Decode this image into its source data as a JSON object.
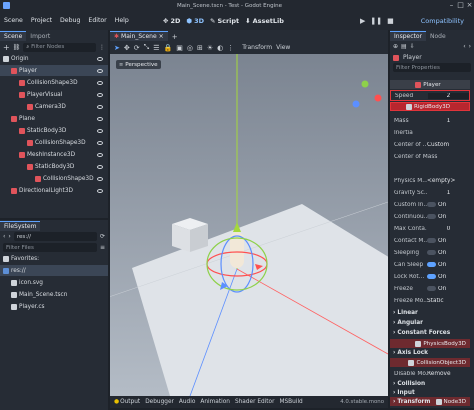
{
  "window": {
    "title": "Main_Scene.tscn - Test - Godot Engine"
  },
  "menu": {
    "items": [
      "Scene",
      "Project",
      "Debug",
      "Editor",
      "Help"
    ]
  },
  "workspaces": [
    {
      "label": "2D"
    },
    {
      "label": "3D"
    },
    {
      "label": "Script"
    },
    {
      "label": "AssetLib"
    }
  ],
  "renderer": "Compatibility",
  "scene_dock": {
    "tabs": [
      "Scene",
      "Import"
    ],
    "filter_placeholder": "Filter Nodes",
    "nodes": [
      {
        "label": "Origin",
        "icon": "white",
        "indent": 0
      },
      {
        "label": "Player",
        "icon": "red",
        "indent": 1
      },
      {
        "label": "CollisionShape3D",
        "icon": "red",
        "indent": 2
      },
      {
        "label": "PlayerVisual",
        "icon": "red",
        "indent": 2
      },
      {
        "label": "Camera3D",
        "icon": "red",
        "indent": 3
      },
      {
        "label": "Plane",
        "icon": "red",
        "indent": 1
      },
      {
        "label": "StaticBody3D",
        "icon": "red",
        "indent": 2
      },
      {
        "label": "CollisionShape3D",
        "icon": "red",
        "indent": 3
      },
      {
        "label": "MeshInstance3D",
        "icon": "red",
        "indent": 2
      },
      {
        "label": "StaticBody3D",
        "icon": "red",
        "indent": 3
      },
      {
        "label": "CollisionShape3D",
        "icon": "red",
        "indent": 4
      },
      {
        "label": "DirectionalLight3D",
        "icon": "red",
        "indent": 1
      }
    ]
  },
  "filesystem": {
    "title": "FileSystem",
    "path": "res://",
    "filter_placeholder": "Filter Files",
    "items": [
      {
        "label": "Favorites:",
        "icon": "white",
        "indent": 0
      },
      {
        "label": "res://",
        "icon": "folder",
        "indent": 0
      },
      {
        "label": "icon.svg",
        "icon": "white",
        "indent": 1
      },
      {
        "label": "Main_Scene.tscn",
        "icon": "white",
        "indent": 1
      },
      {
        "label": "Player.cs",
        "icon": "white",
        "indent": 1
      }
    ]
  },
  "viewport": {
    "tab": "Main_Scene",
    "perspective": "Perspective",
    "transform_menu": "Transform",
    "view_menu": "View"
  },
  "inspector": {
    "tabs": [
      "Inspector",
      "Node"
    ],
    "node_name": "Player",
    "filter_placeholder": "Filter Properties",
    "player_label": "Player",
    "speed_label": "Speed",
    "speed_value": "2",
    "rigid_label": "RigidBody3D",
    "mass_label": "Mass",
    "mass_value": "1",
    "inertia_label": "Inertia",
    "center_mode_label": "Center of ...",
    "center_mode_value": "Custom",
    "center_mass_label": "Center of Mass",
    "physics_label": "Physics M...",
    "physics_value": "<empty>",
    "gravity_label": "Gravity Sc...",
    "gravity_value": "1",
    "custom_label": "Custom In...",
    "custom_value": "On",
    "continuous_label": "Continuou...",
    "continuous_value": "On",
    "max_contacts_label": "Max Conta...",
    "max_contacts_value": "0",
    "contact_label": "Contact M...",
    "contact_value": "On",
    "sleeping_label": "Sleeping",
    "sleeping_value": "On",
    "cansleep_label": "Can Sleep",
    "cansleep_value": "On",
    "lockrot_label": "Lock Rot...",
    "lockrot_value": "On",
    "freeze_label": "Freeze",
    "freeze_value": "On",
    "freezemode_label": "Freeze Mo...",
    "freezemode_value": "Static",
    "sections": [
      "Linear",
      "Angular",
      "Constant Forces"
    ],
    "physicsbody": "PhysicsBody3D",
    "axis_lock": "Axis Lock",
    "collision_object": "CollisionObject3D",
    "disable_mode_label": "Disable Mo...",
    "disable_mode_value": "Remove",
    "sections2": [
      "Collision",
      "Input"
    ],
    "node3d": "Node3D",
    "transform": "Transform"
  },
  "bottom": {
    "tabs": [
      "Output",
      "Debugger",
      "Audio",
      "Animation",
      "Shader Editor",
      "MSBuild"
    ],
    "version": "4.0.stable.mono"
  },
  "colors": {
    "accent": "#5ea2ff",
    "highlight": "#e0343b"
  }
}
